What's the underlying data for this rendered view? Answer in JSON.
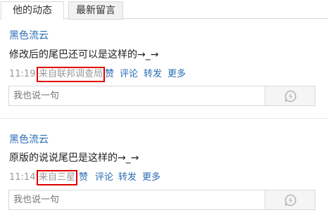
{
  "tabs": [
    {
      "label": "他的动态",
      "active": true
    },
    {
      "label": "最新留言",
      "active": false
    }
  ],
  "posts": [
    {
      "author": "黑色流云",
      "content": "修改后的尾巴还可以是这样的→_→",
      "time": "11:19",
      "source": "来自联邦调查局",
      "actions": [
        "赞",
        "评论",
        "转发",
        "更多"
      ],
      "reply_placeholder": "我也说一句"
    },
    {
      "author": "黑色流云",
      "content": "原版的说说尾巴是这样的→_→",
      "time": "11:14",
      "source": "来自三星",
      "actions": [
        "赞",
        "评论",
        "转发",
        "更多"
      ],
      "reply_placeholder": "我也说一句"
    }
  ],
  "icons": {
    "send": "lightning-bubble-icon"
  },
  "colors": {
    "link": "#2a6cb5",
    "muted": "#999999",
    "highlight_box": "#e00000"
  }
}
